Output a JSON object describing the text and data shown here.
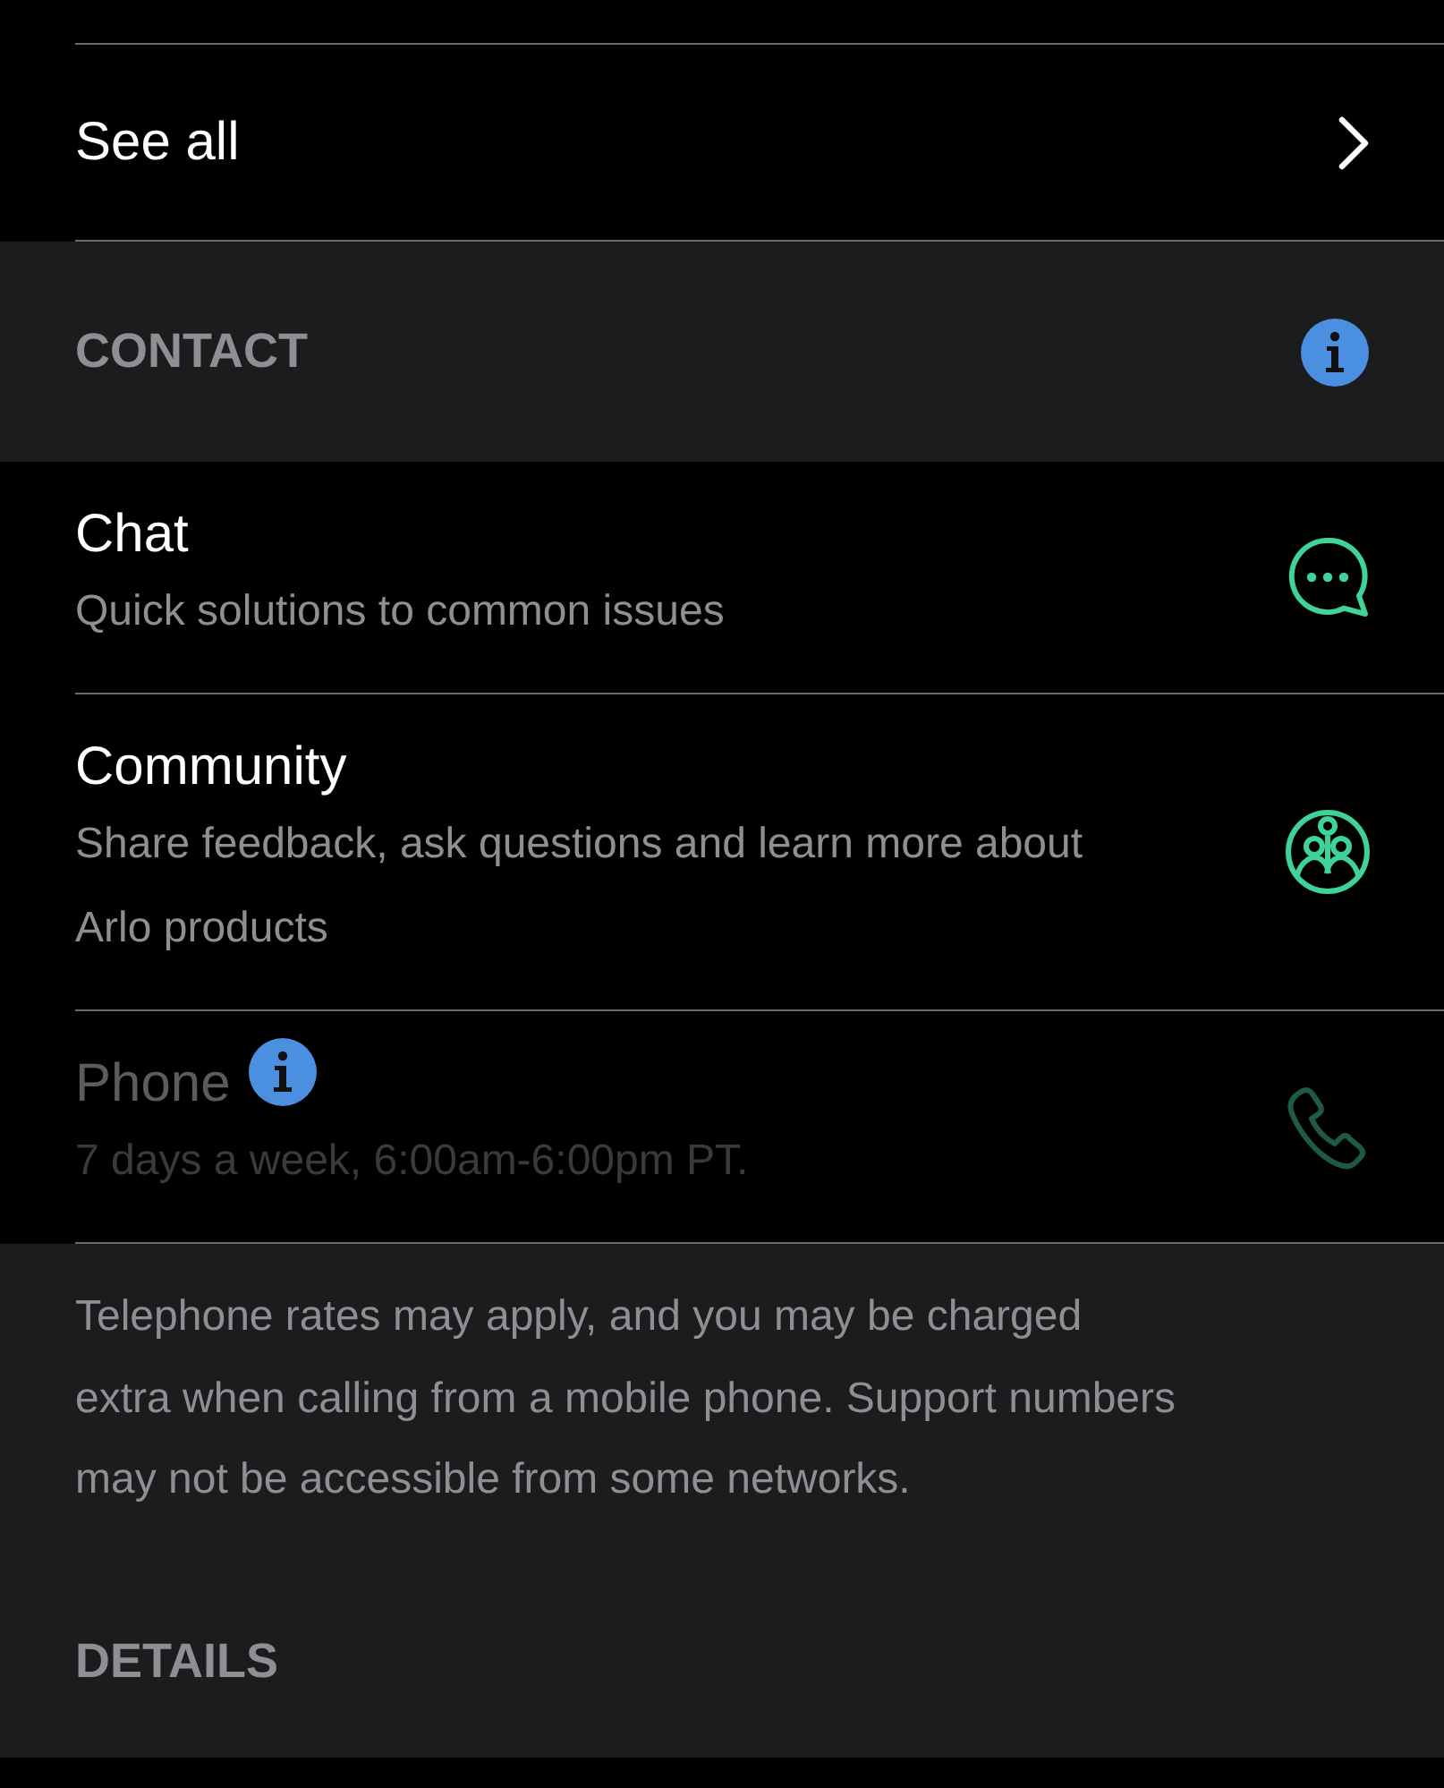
{
  "see_all": {
    "label": "See all"
  },
  "contact": {
    "header": "CONTACT",
    "items": [
      {
        "kind": "chat",
        "title": "Chat",
        "subtitle": "Quick solutions to common issues",
        "disabled": false,
        "info": false
      },
      {
        "kind": "community",
        "title": "Community",
        "subtitle": "Share feedback, ask questions and learn more about Arlo products",
        "disabled": false,
        "info": false
      },
      {
        "kind": "phone",
        "title": "Phone",
        "subtitle": "7 days a week, 6:00am-6:00pm PT.",
        "disabled": true,
        "info": true
      }
    ],
    "note": "Telephone rates may apply, and you may be charged extra when calling from a mobile phone. Support numbers may not be accessible from some networks."
  },
  "details": {
    "header": "DETAILS"
  }
}
